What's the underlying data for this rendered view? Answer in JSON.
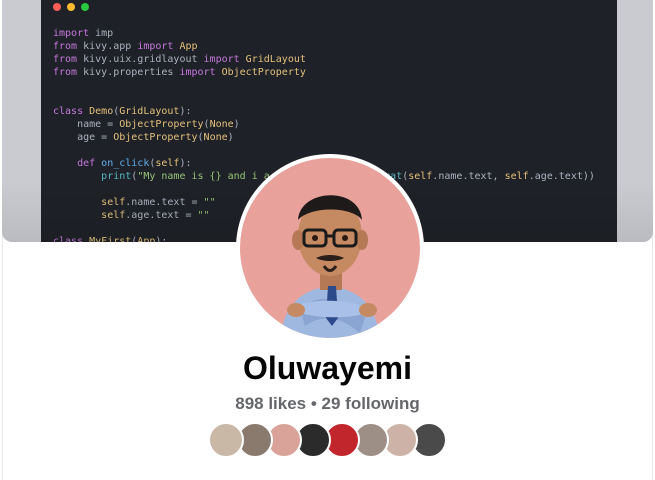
{
  "cover": {
    "code_lines": [
      [
        [
          "k",
          "import"
        ],
        [
          "p",
          " imp"
        ]
      ],
      [
        [
          "k",
          "from"
        ],
        [
          "p",
          " kivy.app "
        ],
        [
          "k",
          "import"
        ],
        [
          "c",
          " App"
        ]
      ],
      [
        [
          "k",
          "from"
        ],
        [
          "p",
          " kivy.uix.gridlayout "
        ],
        [
          "k",
          "import"
        ],
        [
          "c",
          " GridLayout"
        ]
      ],
      [
        [
          "k",
          "from"
        ],
        [
          "p",
          " kivy.properties "
        ],
        [
          "k",
          "import"
        ],
        [
          "c",
          " ObjectProperty"
        ]
      ],
      [],
      [],
      [
        [
          "k",
          "class"
        ],
        [
          "c",
          " Demo"
        ],
        [
          "p",
          "("
        ],
        [
          "c",
          "GridLayout"
        ],
        [
          "p",
          "):"
        ]
      ],
      [
        [
          "p",
          "    name = "
        ],
        [
          "c",
          "ObjectProperty"
        ],
        [
          "p",
          "("
        ],
        [
          "c",
          "None"
        ],
        [
          "p",
          ")"
        ]
      ],
      [
        [
          "p",
          "    age = "
        ],
        [
          "c",
          "ObjectProperty"
        ],
        [
          "p",
          "("
        ],
        [
          "c",
          "None"
        ],
        [
          "p",
          ")"
        ]
      ],
      [],
      [
        [
          "p",
          "    "
        ],
        [
          "k",
          "def"
        ],
        [
          "f",
          " on_click"
        ],
        [
          "p",
          "("
        ],
        [
          "c",
          "self"
        ],
        [
          "p",
          "):"
        ]
      ],
      [
        [
          "p",
          "        "
        ],
        [
          "m",
          "print"
        ],
        [
          "p",
          "("
        ],
        [
          "s",
          "\"My name is {} and i a"
        ],
        [
          "p",
          "                   "
        ],
        [
          "m",
          "mat"
        ],
        [
          "p",
          "("
        ],
        [
          "c",
          "self"
        ],
        [
          "p",
          ".name.text, "
        ],
        [
          "c",
          "self"
        ],
        [
          "p",
          ".age.text))"
        ]
      ],
      [],
      [
        [
          "p",
          "        "
        ],
        [
          "c",
          "self"
        ],
        [
          "p",
          ".name.text = "
        ],
        [
          "s",
          "\"\""
        ]
      ],
      [
        [
          "p",
          "        "
        ],
        [
          "c",
          "self"
        ],
        [
          "p",
          ".age.text = "
        ],
        [
          "s",
          "\"\""
        ]
      ],
      [],
      [
        [
          "k",
          "class"
        ],
        [
          "c",
          " MyFirst"
        ],
        [
          "p",
          "("
        ],
        [
          "c",
          "App"
        ],
        [
          "p",
          "):"
        ]
      ]
    ]
  },
  "profile": {
    "name": "Oluwayemi",
    "stats": "898 likes • 29 following"
  },
  "colors": {
    "avatar_bg": "#e8a19b",
    "friend_avatars": [
      "#c9b8a6",
      "#8a7a6e",
      "#d9a39a",
      "#2b2b2b",
      "#c0262c",
      "#9e8f86",
      "#cdb2a8",
      "#4a4a4a"
    ]
  }
}
